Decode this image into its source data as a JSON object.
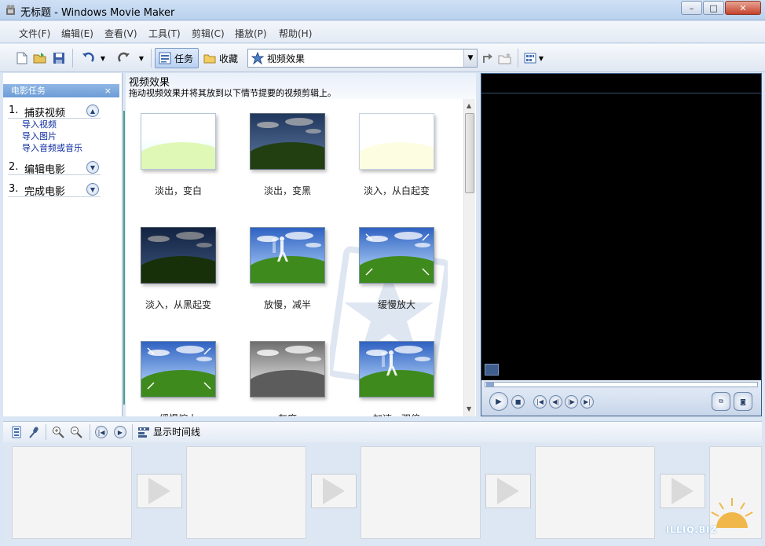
{
  "window": {
    "title": "无标题 - Windows Movie Maker",
    "min": "–",
    "max": "□",
    "close": "✕"
  },
  "menu": [
    "文件(F)",
    "编辑(E)",
    "查看(V)",
    "工具(T)",
    "剪辑(C)",
    "播放(P)",
    "帮助(H)"
  ],
  "toolbar": {
    "tasks_label": "任务",
    "favorites_label": "收藏",
    "combo_value": "视频效果"
  },
  "tasks": {
    "header": "电影任务",
    "close": "×",
    "sections": [
      {
        "num": "1.",
        "label": "捕获视频",
        "state": "▲"
      },
      {
        "num": "2.",
        "label": "编辑电影",
        "state": "▼"
      },
      {
        "num": "3.",
        "label": "完成电影",
        "state": "▼"
      }
    ],
    "capture_links": [
      "导入视频",
      "导入图片",
      "导入音频或音乐"
    ]
  },
  "effects": {
    "title": "视频效果",
    "description": "拖动视频效果并将其放到以下情节提要的视频剪辑上。",
    "tiles": [
      {
        "label": "淡出，变白",
        "style": "white-out"
      },
      {
        "label": "淡出，变黑",
        "style": "black-out"
      },
      {
        "label": "淡入，从白起变",
        "style": "white-in"
      },
      {
        "label": "淡入，从黑起变",
        "style": "black-in"
      },
      {
        "label": "放慢，减半",
        "style": "slow"
      },
      {
        "label": "缓慢放大",
        "style": "zoom-in"
      },
      {
        "label": "缓慢缩小",
        "style": "zoom-out"
      },
      {
        "label": "灰度",
        "style": "gray"
      },
      {
        "label": "加速，双倍",
        "style": "fast"
      }
    ]
  },
  "storyboard": {
    "show_timeline": "显示时间线"
  },
  "watermark": "ILLIQ.BIZ",
  "colors": {
    "accent": "#6d9cd6",
    "link": "#0b2aa0",
    "rule": "#4a9a8a",
    "preview_bg": "#000000"
  }
}
